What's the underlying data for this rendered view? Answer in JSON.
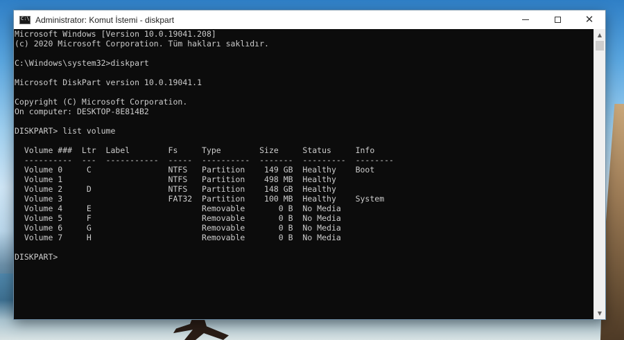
{
  "window": {
    "title": "Administrator: Komut İstemi - diskpart",
    "minimize_label": "Minimize",
    "maximize_label": "Maximize",
    "close_label": "Close"
  },
  "console": {
    "lines": [
      "Microsoft Windows [Version 10.0.19041.208]",
      "(c) 2020 Microsoft Corporation. Tüm hakları saklıdır.",
      "",
      "C:\\Windows\\system32>diskpart",
      "",
      "Microsoft DiskPart version 10.0.19041.1",
      "",
      "Copyright (C) Microsoft Corporation.",
      "On computer: DESKTOP-8E814B2",
      "",
      "DISKPART> list volume",
      "",
      "  Volume ###  Ltr  Label        Fs     Type        Size     Status     Info",
      "  ----------  ---  -----------  -----  ----------  -------  ---------  --------",
      "  Volume 0     C                NTFS   Partition    149 GB  Healthy    Boot",
      "  Volume 1                      NTFS   Partition    498 MB  Healthy",
      "  Volume 2     D                NTFS   Partition    148 GB  Healthy",
      "  Volume 3                      FAT32  Partition    100 MB  Healthy    System",
      "  Volume 4     E                       Removable       0 B  No Media",
      "  Volume 5     F                       Removable       0 B  No Media",
      "  Volume 6     G                       Removable       0 B  No Media",
      "  Volume 7     H                       Removable       0 B  No Media",
      "",
      "DISKPART> "
    ]
  },
  "scrollbar": {
    "up_icon": "▲",
    "down_icon": "▼"
  },
  "colors": {
    "console_bg": "#0c0c0c",
    "console_fg": "#cccccc",
    "titlebar_bg": "#ffffff"
  }
}
